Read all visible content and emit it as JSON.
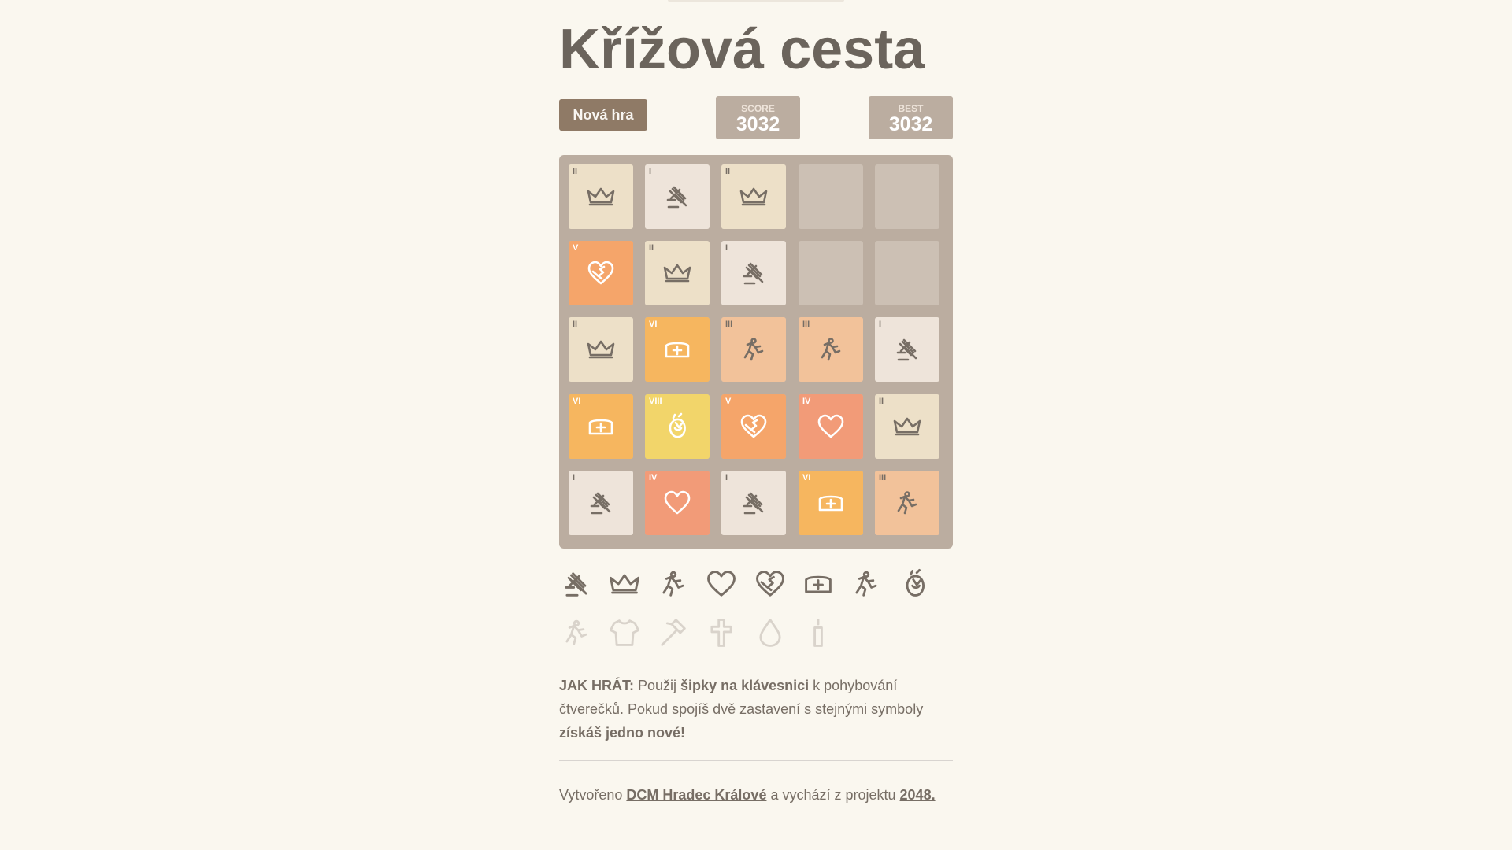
{
  "title": "Křížová cesta",
  "new_game_label": "Nová hra",
  "score": {
    "label": "SCORE",
    "value": "3032"
  },
  "best": {
    "label": "BEST",
    "value": "3032"
  },
  "colors": {
    "background": "#faf7ef",
    "board": "#bbada0",
    "button": "#8f7a66",
    "text": "#776e65"
  },
  "grid": [
    [
      {
        "level": 2,
        "label": "II",
        "icon": "crown-icon"
      },
      {
        "level": 1,
        "label": "I",
        "icon": "gavel-icon"
      },
      {
        "level": 2,
        "label": "II",
        "icon": "crown-icon"
      },
      null,
      null
    ],
    [
      {
        "level": 5,
        "label": "V",
        "icon": "broken-heart-icon"
      },
      {
        "level": 2,
        "label": "II",
        "icon": "crown-icon"
      },
      {
        "level": 1,
        "label": "I",
        "icon": "gavel-icon"
      },
      null,
      null
    ],
    [
      {
        "level": 2,
        "label": "II",
        "icon": "crown-icon"
      },
      {
        "level": 6,
        "label": "VI",
        "icon": "nurse-cap-icon"
      },
      {
        "level": 3,
        "label": "III",
        "icon": "falling-person-icon"
      },
      {
        "level": 3,
        "label": "III",
        "icon": "falling-person-icon"
      },
      {
        "level": 1,
        "label": "I",
        "icon": "gavel-icon"
      }
    ],
    [
      {
        "level": 6,
        "label": "VI",
        "icon": "nurse-cap-icon"
      },
      {
        "level": 8,
        "label": "VIII",
        "icon": "rose-icon"
      },
      {
        "level": 5,
        "label": "V",
        "icon": "broken-heart-icon"
      },
      {
        "level": 4,
        "label": "IV",
        "icon": "heart-icon"
      },
      {
        "level": 2,
        "label": "II",
        "icon": "crown-icon"
      }
    ],
    [
      {
        "level": 1,
        "label": "I",
        "icon": "gavel-icon"
      },
      {
        "level": 4,
        "label": "IV",
        "icon": "heart-icon"
      },
      {
        "level": 1,
        "label": "I",
        "icon": "gavel-icon"
      },
      {
        "level": 6,
        "label": "VI",
        "icon": "nurse-cap-icon"
      },
      {
        "level": 3,
        "label": "III",
        "icon": "falling-person-icon"
      }
    ]
  ],
  "legend": {
    "unlocked": [
      "gavel-icon",
      "crown-icon",
      "falling-person-icon",
      "heart-icon",
      "broken-heart-icon",
      "nurse-cap-icon",
      "falling-person-icon",
      "rose-icon"
    ],
    "locked": [
      "falling-person-icon",
      "shirt-icon",
      "hammer-icon",
      "cross-icon",
      "drop-icon",
      "candle-icon"
    ]
  },
  "howto": {
    "label": "JAK HRÁT:",
    "t1": " Použij ",
    "b1": "šipky na klávesnici",
    "t2": " k pohybování čtverečků. Pokud spojíš dvě zastavení s stejnými symboly ",
    "b2": "získáš jedno nové!"
  },
  "footer": {
    "t1": "Vytvořeno ",
    "link1": "DCM Hradec Králové",
    "t2": " a vychází z projektu ",
    "link2": "2048."
  }
}
